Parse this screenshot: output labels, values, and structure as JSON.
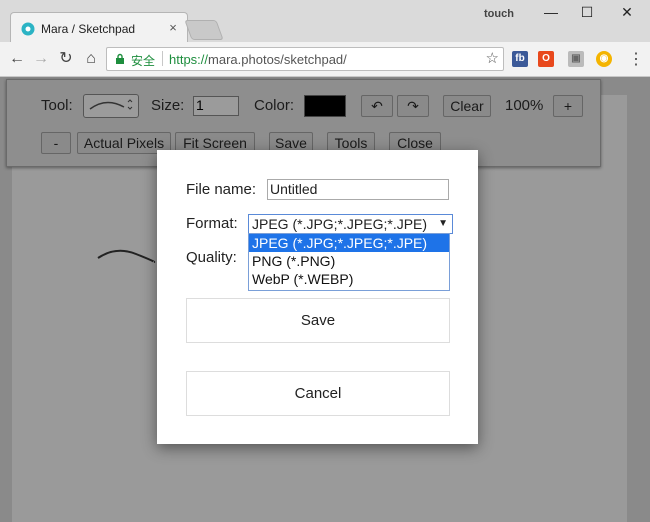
{
  "browser": {
    "tab_title": "Mara / Sketchpad",
    "tab_close": "×",
    "profile": "touch",
    "window": {
      "minimize": "—",
      "maximize": "☐",
      "close": "✕"
    },
    "nav": {
      "back": "←",
      "forward": "→",
      "reload": "↻",
      "home": "⌂"
    },
    "secure_label": "安全",
    "url_scheme": "https://",
    "url_rest": "mara.photos/sketchpad/",
    "star": "☆",
    "extensions": [
      "fb",
      "O",
      "▣",
      "◉"
    ],
    "menu": "⋮"
  },
  "app_toolbar": {
    "tool_label": "Tool:",
    "size_label": "Size:",
    "size_value": "1",
    "color_label": "Color:",
    "undo": "↶",
    "redo": "↷",
    "clear": "Clear",
    "zoom": "100%",
    "zoom_in": "+",
    "zoom_out": "-",
    "actual_pixels": "Actual Pixels",
    "fit_screen": "Fit Screen",
    "save": "Save",
    "tools": "Tools",
    "close": "Close"
  },
  "dialog": {
    "file_name_label": "File name:",
    "file_name_value": "Untitled",
    "format_label": "Format:",
    "format_selected": "JPEG (*.JPG;*.JPEG;*.JPE)",
    "format_arrow": "▼",
    "format_options": [
      "JPEG (*.JPG;*.JPEG;*.JPE)",
      "PNG (*.PNG)",
      "WebP (*.WEBP)"
    ],
    "quality_label": "Quality:",
    "save_button": "Save",
    "cancel_button": "Cancel"
  },
  "colors": {
    "accent": "#1e73e8",
    "secure_green": "#1e8e3e"
  }
}
